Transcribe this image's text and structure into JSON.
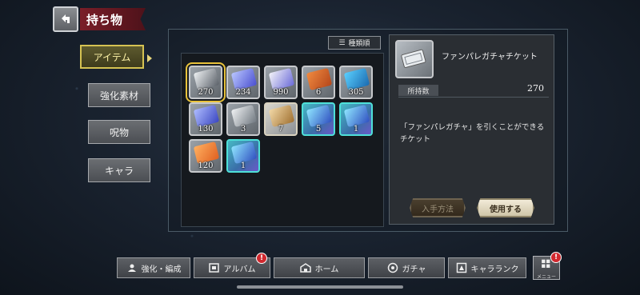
{
  "header": {
    "title": "持ち物"
  },
  "nav": {
    "items": [
      {
        "label": "アイテム",
        "active": true
      },
      {
        "label": "強化素材",
        "active": false
      },
      {
        "label": "呪物",
        "active": false
      },
      {
        "label": "キャラ",
        "active": false
      }
    ]
  },
  "sort": {
    "label": "種類順"
  },
  "items": [
    {
      "count": "270",
      "rarity": "silver",
      "selected": true,
      "art": "ticket"
    },
    {
      "count": "234",
      "rarity": "silver",
      "selected": false,
      "art": "ticket-crystal"
    },
    {
      "count": "990",
      "rarity": "silver",
      "selected": false,
      "art": "cards"
    },
    {
      "count": "6",
      "rarity": "silver",
      "selected": false,
      "art": "leaves"
    },
    {
      "count": "305",
      "rarity": "silver",
      "selected": false,
      "art": "capsule"
    },
    {
      "count": "130",
      "rarity": "silver",
      "selected": false,
      "art": "ticket-blue"
    },
    {
      "count": "3",
      "rarity": "silver",
      "selected": false,
      "art": "sword"
    },
    {
      "count": "7",
      "rarity": "gold",
      "selected": false,
      "art": "scroll"
    },
    {
      "count": "5",
      "rarity": "rare",
      "selected": false,
      "art": "ticket-rare"
    },
    {
      "count": "1",
      "rarity": "rare",
      "selected": false,
      "art": "ticket-rare"
    },
    {
      "count": "120",
      "rarity": "silver",
      "selected": false,
      "art": "ticket-orange"
    },
    {
      "count": "1",
      "rarity": "rare",
      "selected": false,
      "art": "ticket-rare"
    }
  ],
  "detail": {
    "name": "ファンパレガチャチケット",
    "owned_label": "所持数",
    "owned_value": "270",
    "description": "「ファンパレガチャ」を引くことができるチケット",
    "obtain_label": "入手方法",
    "use_label": "使用する"
  },
  "bottom_nav": [
    {
      "label": "強化・編成",
      "icon": "people-icon",
      "badge": false
    },
    {
      "label": "アルバム",
      "icon": "album-icon",
      "badge": true
    },
    {
      "label": "ホーム",
      "icon": "home-icon",
      "badge": false
    },
    {
      "label": "ガチャ",
      "icon": "gacha-icon",
      "badge": false
    },
    {
      "label": "キャラランク",
      "icon": "rank-icon",
      "badge": false
    }
  ],
  "menu": {
    "label": "メニュー",
    "badge": true
  },
  "badge_text": "!"
}
